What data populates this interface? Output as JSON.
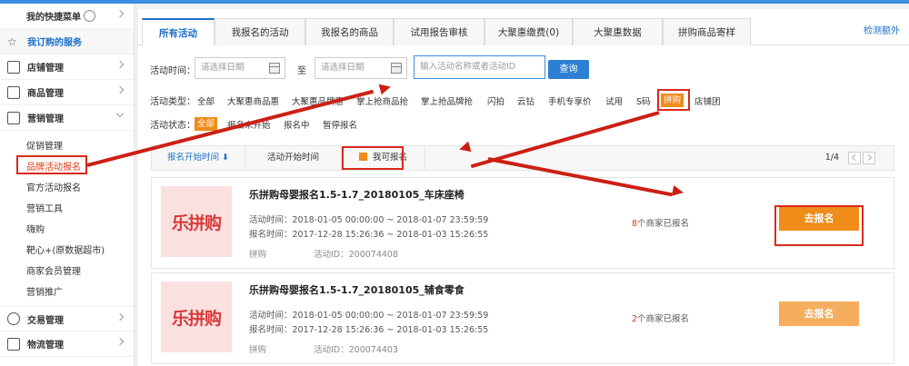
{
  "sidebar": {
    "quick_menu": "我的快捷菜单",
    "my_services": "我订购的服务",
    "shop_mgmt": "店铺管理",
    "goods_mgmt": "商品管理",
    "marketing_mgmt": "营销管理",
    "marketing_items": [
      "促销管理",
      "品牌活动报名",
      "官方活动报名",
      "营销工具",
      "嗨购",
      "靶心+(原数据超市)",
      "商家会员管理",
      "营销推广"
    ],
    "trade_mgmt": "交易管理",
    "logistics_mgmt": "物流管理"
  },
  "tabs": [
    "所有活动",
    "我报名的活动",
    "我报名的商品",
    "试用报告审核",
    "大聚惠缴费(0)",
    "大聚惠数据",
    "拼购商品寄样"
  ],
  "tab_link": "检测额外",
  "filter": {
    "time_label": "活动时间：",
    "date_placeholder": "请选择日期",
    "to_label": "至",
    "search_placeholder": "输入活动名称或者活动ID",
    "query_button": "查询",
    "type_label": "活动类型：",
    "types": [
      "全部",
      "大聚惠商品惠",
      "大聚惠品牌惠",
      "掌上抢商品抢",
      "掌上抢品牌抢",
      "闪拍",
      "云钻",
      "手机专享价",
      "试用",
      "S码",
      "拼购",
      "店铺团"
    ],
    "selected_type": "拼购",
    "status_label": "活动状态：",
    "statuses": [
      "全部",
      "报名未开始",
      "报名中",
      "暂停报名"
    ],
    "selected_status": "全部"
  },
  "list": {
    "sort_signup_time": "报名开始时间 ⬇",
    "sort_activity_time": "活动开始时间",
    "can_signup": "我可报名",
    "page": "1/4"
  },
  "cards": [
    {
      "logo": "乐拼购",
      "title": "乐拼购母婴报名1.5-1.7_20180105_车床座椅",
      "activity_time": "活动时间：2018-01-05 00:00:00 ~ 2018-01-07 23:59:59",
      "signup_time": "报名时间：2017-12-28 15:26:36 ~ 2018-01-03 15:26:55",
      "type": "拼购",
      "activity_id": "活动ID：200074408",
      "count": "8",
      "count_suffix": "个商家已报名",
      "button": "去报名"
    },
    {
      "logo": "乐拼购",
      "title": "乐拼购母婴报名1.5-1.7_20180105_辅食零食",
      "activity_time": "活动时间：2018-01-05 00:00:00 ~ 2018-01-07 23:59:59",
      "signup_time": "报名时间：2017-12-28 15:26:36 ~ 2018-01-03 15:26:55",
      "type": "拼购",
      "activity_id": "活动ID：200074403",
      "count": "2",
      "count_suffix": "个商家已报名",
      "button": "去报名"
    }
  ],
  "colors": {
    "accent": "#1c6fc7",
    "orange": "#f08c1a",
    "annotation_red": "#cc1f14"
  }
}
